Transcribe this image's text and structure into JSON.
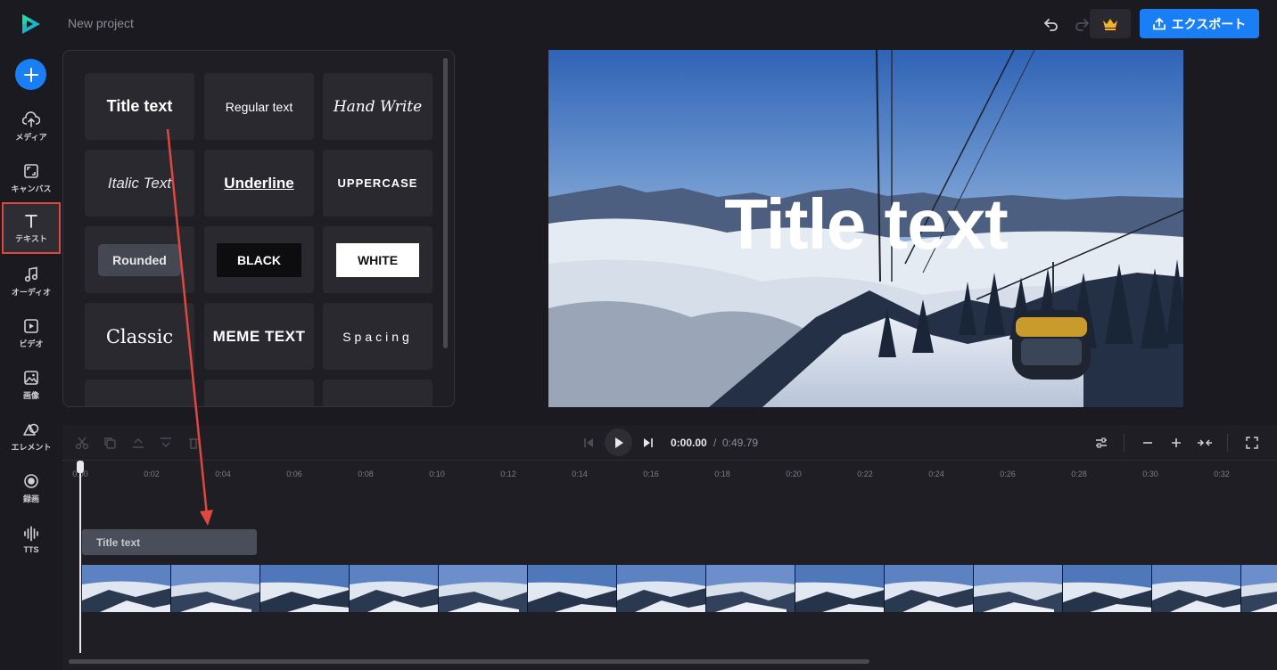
{
  "header": {
    "project_name": "New project",
    "export_label": "エクスポート",
    "undo_icon": "undo-icon",
    "redo_icon": "redo-icon",
    "premium_icon": "crown-icon"
  },
  "sidebar": {
    "items": [
      {
        "label": "メディア",
        "icon": "cloud-upload-icon"
      },
      {
        "label": "キャンバス",
        "icon": "canvas-icon"
      },
      {
        "label": "テキスト",
        "icon": "text-icon"
      },
      {
        "label": "オーディオ",
        "icon": "music-note-icon"
      },
      {
        "label": "ビデオ",
        "icon": "video-icon"
      },
      {
        "label": "画像",
        "icon": "image-icon"
      },
      {
        "label": "エレメント",
        "icon": "shapes-icon"
      },
      {
        "label": "録画",
        "icon": "record-icon"
      },
      {
        "label": "TTS",
        "icon": "waveform-icon"
      }
    ],
    "active": "テキスト"
  },
  "text_panel": {
    "styles": [
      "Title text",
      "Regular text",
      "Hand Write",
      "Italic Text",
      "Underline",
      "UPPERCASE",
      "Rounded",
      "BLACK",
      "WHITE",
      "Classic",
      "MEME TEXT",
      "Spacing"
    ]
  },
  "preview": {
    "overlay_text": "Title text"
  },
  "timeline": {
    "current_time": "0:00.00",
    "separator": "/",
    "total_time": "0:49.79",
    "ticks": [
      "0:00",
      "0:02",
      "0:04",
      "0:06",
      "0:08",
      "0:10",
      "0:12",
      "0:14",
      "0:16",
      "0:18",
      "0:20",
      "0:22",
      "0:24",
      "0:26",
      "0:28",
      "0:30",
      "0:32"
    ],
    "text_clip_label": "Title text"
  },
  "colors": {
    "accent": "#1a7ef5",
    "highlight": "#e0473e",
    "background": "#1b1a20",
    "panel": "#1f1e25"
  }
}
